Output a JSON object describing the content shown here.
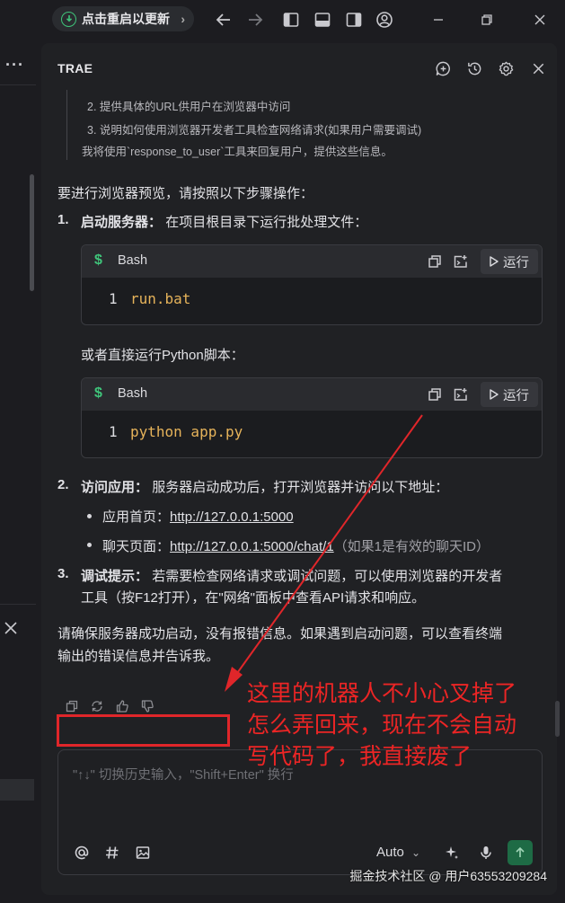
{
  "titlebar": {
    "update_label": "点击重启以更新",
    "icons": [
      "download-icon",
      "back-arrow-icon",
      "forward-arrow-icon",
      "toggle-left-panel-icon",
      "toggle-bottom-panel-icon",
      "toggle-right-panel-icon",
      "account-icon",
      "minimize-icon",
      "restore-icon",
      "close-icon"
    ]
  },
  "panel": {
    "title": "TRAE",
    "thought": {
      "line2": "2. 提供具体的URL供用户在浏览器中访问",
      "line3": "3. 说明如何使用浏览器开发者工具检查网络请求(如果用户需要调试)",
      "line4": "我将使用`response_to_user`工具来回复用户，提供这些信息。"
    },
    "message": {
      "intro": "要进行浏览器预览，请按照以下步骤操作：",
      "step1_num": "1.",
      "step1_title": "启动服务器：",
      "step1_text": "在项目根目录下运行批处理文件：",
      "code1": {
        "lang": "Bash",
        "run_label": "运行",
        "line_no": "1",
        "code": "run.bat"
      },
      "or_text": "或者直接运行Python脚本：",
      "code2": {
        "lang": "Bash",
        "run_label": "运行",
        "line_no": "1",
        "code": "python app.py"
      },
      "step2_num": "2.",
      "step2_title": "访问应用：",
      "step2_text": "服务器启动成功后，打开浏览器并访问以下地址：",
      "bullet1_label": "应用首页：",
      "bullet1_link": "http://127.0.0.1:5000",
      "bullet2_label": "聊天页面：",
      "bullet2_link": "http://127.0.0.1:5000/chat/1",
      "bullet2_note": "（如果1是有效的聊天ID）",
      "step3_num": "3.",
      "step3_title": "调试提示：",
      "step3_text1": "若需要检查网络请求或调试问题，可以使用浏览器的开发者",
      "step3_text2": "工具（按F12打开），在\"网络\"面板中查看API请求和响应。",
      "closing1": "请确保服务器成功启动，没有报错信息。如果遇到启动问题，可以查看终端",
      "closing2": "输出的错误信息并告诉我。"
    },
    "input": {
      "placeholder": "\"↑↓\" 切换历史输入，\"Shift+Enter\" 换行",
      "model": "Auto"
    }
  },
  "annotation": {
    "text": "这里的机器人不小心叉掉了怎么弄回来，现在不会自动写代码了，我直接废了",
    "color": "#ec2525"
  },
  "watermark": "掘金技术社区 @ 用户63553209284"
}
